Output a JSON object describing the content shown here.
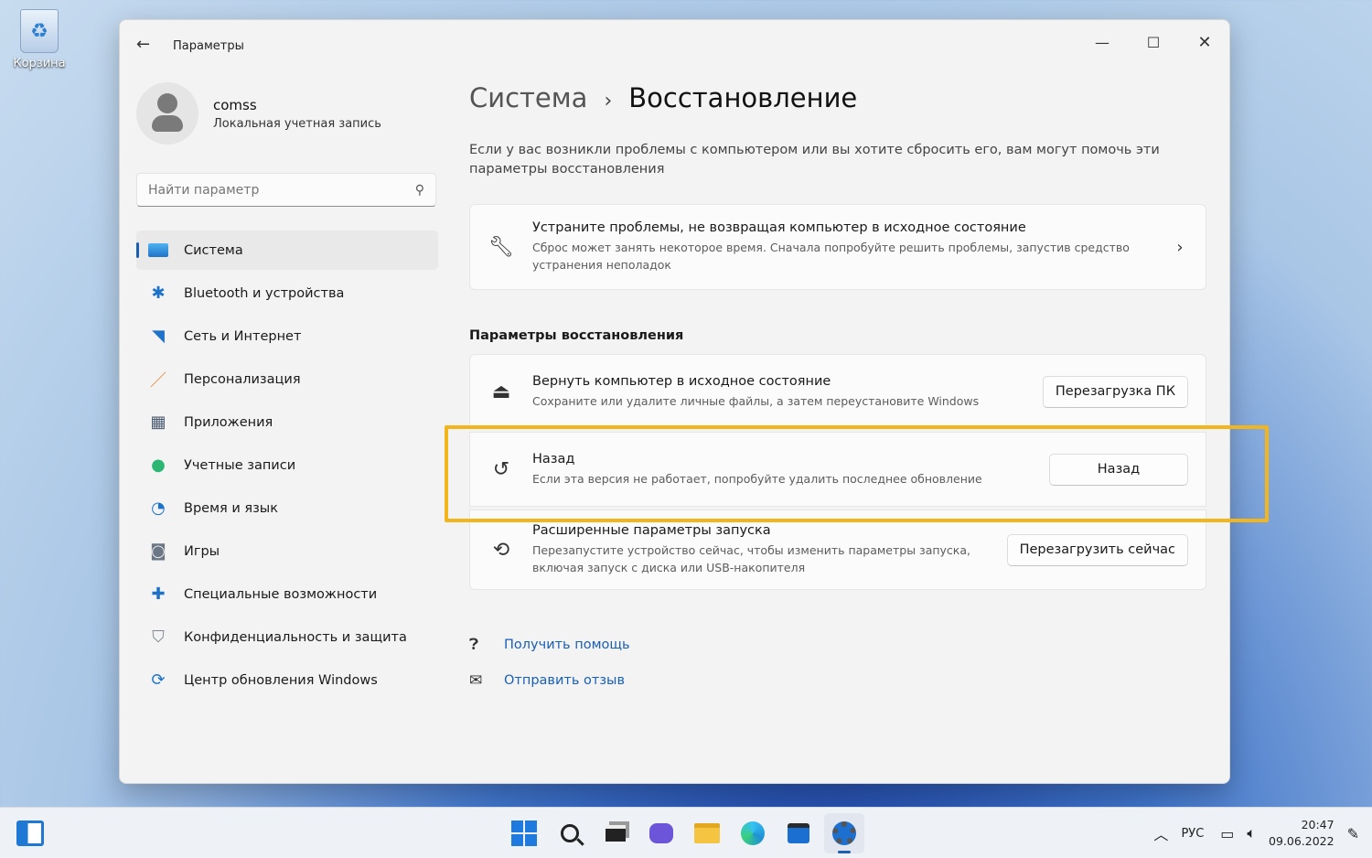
{
  "desktop": {
    "recycle_bin_label": "Корзина"
  },
  "window": {
    "title": "Параметры"
  },
  "user": {
    "name": "comss",
    "account_type": "Локальная учетная запись"
  },
  "search": {
    "placeholder": "Найти параметр"
  },
  "nav": [
    {
      "label": "Система",
      "icon": "display-icon",
      "active": true
    },
    {
      "label": "Bluetooth и устройства",
      "icon": "bluetooth-icon"
    },
    {
      "label": "Сеть и Интернет",
      "icon": "wifi-icon"
    },
    {
      "label": "Персонализация",
      "icon": "brush-icon"
    },
    {
      "label": "Приложения",
      "icon": "apps-icon"
    },
    {
      "label": "Учетные записи",
      "icon": "account-icon"
    },
    {
      "label": "Время и язык",
      "icon": "globe-clock-icon"
    },
    {
      "label": "Игры",
      "icon": "gamepad-icon"
    },
    {
      "label": "Специальные возможности",
      "icon": "accessibility-icon"
    },
    {
      "label": "Конфиденциальность и защита",
      "icon": "shield-icon"
    },
    {
      "label": "Центр обновления Windows",
      "icon": "update-icon"
    }
  ],
  "breadcrumb": {
    "parent": "Система",
    "separator": "›",
    "current": "Восстановление"
  },
  "description": "Если у вас возникли проблемы с компьютером или вы хотите сбросить его, вам могут помочь эти параметры восстановления",
  "troubleshoot": {
    "title": "Устраните проблемы, не возвращая компьютер в исходное состояние",
    "subtitle": "Сброс может занять некоторое время. Сначала попробуйте решить проблемы, запустив средство устранения неполадок"
  },
  "section_title": "Параметры восстановления",
  "options": [
    {
      "title": "Вернуть компьютер в исходное состояние",
      "subtitle": "Сохраните или удалите личные файлы, а затем переустановите Windows",
      "button": "Перезагрузка ПК"
    },
    {
      "title": "Назад",
      "subtitle": "Если эта версия не работает, попробуйте удалить последнее обновление",
      "button": "Назад"
    },
    {
      "title": "Расширенные параметры запуска",
      "subtitle": "Перезапустите устройство сейчас, чтобы изменить параметры запуска, включая запуск с диска или USB-накопителя",
      "button": "Перезагрузить сейчас"
    }
  ],
  "links": {
    "help": "Получить помощь",
    "feedback": "Отправить отзыв"
  },
  "taskbar": {
    "language": "РУС",
    "time": "20:47",
    "date": "09.06.2022"
  },
  "colors": {
    "accent": "#1a5fb4",
    "highlight": "#f2b51b"
  }
}
